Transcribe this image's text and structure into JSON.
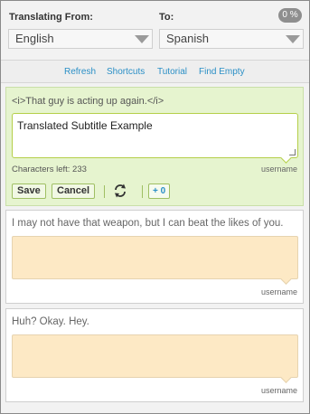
{
  "header": {
    "from_label": "Translating From:",
    "to_label": "To:",
    "progress": "0 %",
    "from_lang": "English",
    "to_lang": "Spanish"
  },
  "links": [
    "Refresh",
    "Shortcuts",
    "Tutorial",
    "Find Empty"
  ],
  "active": {
    "source": "<i>That guy is acting up again.</i>",
    "translation": "Translated Subtitle Example",
    "chars_left": "Characters left: 233",
    "user": "username",
    "save": "Save",
    "cancel": "Cancel",
    "plus": "+ 0"
  },
  "subtitles": [
    {
      "source": "I may not have that weapon, but I can beat the likes of you.",
      "translation": "",
      "user": "username"
    },
    {
      "source": "Huh? Okay. Hey.",
      "translation": "",
      "user": "username"
    }
  ],
  "colors": {
    "accent_link": "#2a8fc6",
    "active_card": "#e6f4cf",
    "empty_translation": "#fde9c5"
  },
  "icons": [
    "caret-down-icon",
    "refresh-sync-icon"
  ]
}
